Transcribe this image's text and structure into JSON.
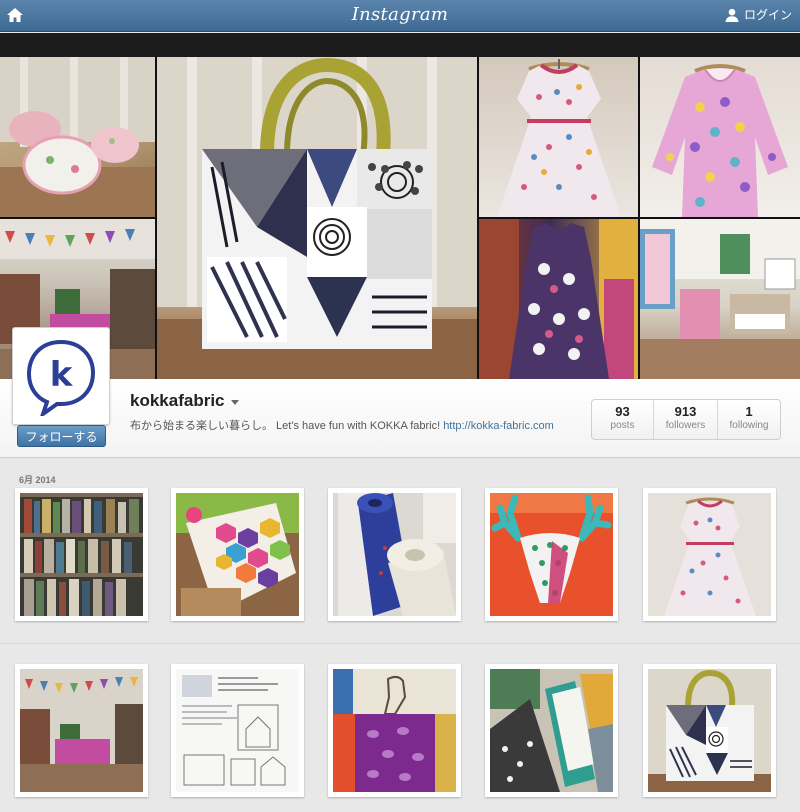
{
  "nav": {
    "brand": "Instagram",
    "login_label": "ログイン",
    "home_icon": "home-icon",
    "user_icon": "user-icon"
  },
  "colors": {
    "nav_bar": "#4a77a0",
    "follow_button": "#4f83b5",
    "link": "#3f729b",
    "page_bg": "#e8e8e8"
  },
  "profile": {
    "username": "kokkafabric",
    "bio": "布から始まる楽しい暮らし。 Let's have fun with KOKKA fabric!",
    "link": "http://kokka-fabric.com",
    "follow_label": "フォローする",
    "avatar_letter": "k",
    "stats": [
      {
        "count": "93",
        "label": "posts"
      },
      {
        "count": "913",
        "label": "followers"
      },
      {
        "count": "1",
        "label": "following"
      }
    ]
  },
  "grid": {
    "month_label": "6月 2014"
  }
}
